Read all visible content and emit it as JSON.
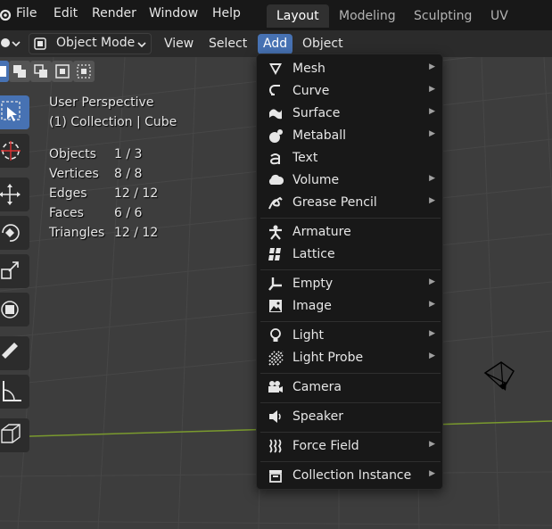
{
  "menubar": {
    "items": [
      "File",
      "Edit",
      "Render",
      "Window",
      "Help"
    ],
    "workspaces": [
      {
        "label": "Layout",
        "active": true
      },
      {
        "label": "Modeling",
        "active": false
      },
      {
        "label": "Sculpting",
        "active": false
      },
      {
        "label": "UV Editing",
        "active": false
      }
    ]
  },
  "header": {
    "mode": "Object Mode",
    "menus": [
      "View",
      "Select",
      "Add",
      "Object"
    ],
    "open_menu": "Add"
  },
  "overlay": {
    "title": "User Perspective",
    "subtitle": "(1) Collection | Cube",
    "stats": [
      {
        "label": "Objects",
        "value": "1 / 3"
      },
      {
        "label": "Vertices",
        "value": "8 / 8"
      },
      {
        "label": "Edges",
        "value": "12 / 12"
      },
      {
        "label": "Faces",
        "value": "6 / 6"
      },
      {
        "label": "Triangles",
        "value": "12 / 12"
      }
    ]
  },
  "add_menu": {
    "items": [
      {
        "label": "Mesh",
        "icon": "mesh-icon",
        "submenu": true
      },
      {
        "label": "Curve",
        "icon": "curve-icon",
        "submenu": true
      },
      {
        "label": "Surface",
        "icon": "surface-icon",
        "submenu": true
      },
      {
        "label": "Metaball",
        "icon": "metaball-icon",
        "submenu": true
      },
      {
        "label": "Text",
        "icon": "text-icon",
        "submenu": false
      },
      {
        "label": "Volume",
        "icon": "volume-icon",
        "submenu": true
      },
      {
        "label": "Grease Pencil",
        "icon": "grease-pencil-icon",
        "submenu": true
      },
      {
        "label": "Armature",
        "icon": "armature-icon",
        "submenu": false
      },
      {
        "label": "Lattice",
        "icon": "lattice-icon",
        "submenu": false
      },
      {
        "label": "Empty",
        "icon": "empty-icon",
        "submenu": true
      },
      {
        "label": "Image",
        "icon": "image-icon",
        "submenu": true
      },
      {
        "label": "Light",
        "icon": "light-icon",
        "submenu": true
      },
      {
        "label": "Light Probe",
        "icon": "light-probe-icon",
        "submenu": true
      },
      {
        "label": "Camera",
        "icon": "camera-icon",
        "submenu": false
      },
      {
        "label": "Speaker",
        "icon": "speaker-icon",
        "submenu": false
      },
      {
        "label": "Force Field",
        "icon": "force-field-icon",
        "submenu": true
      },
      {
        "label": "Collection Instance",
        "icon": "collection-instance-icon",
        "submenu": true
      }
    ],
    "submenu_arrow": "▶"
  },
  "colors": {
    "accent": "#4772b3",
    "menu_bg": "#181818",
    "viewport_bg": "#3d3d3d",
    "x_axis": "#7a9a2e"
  }
}
